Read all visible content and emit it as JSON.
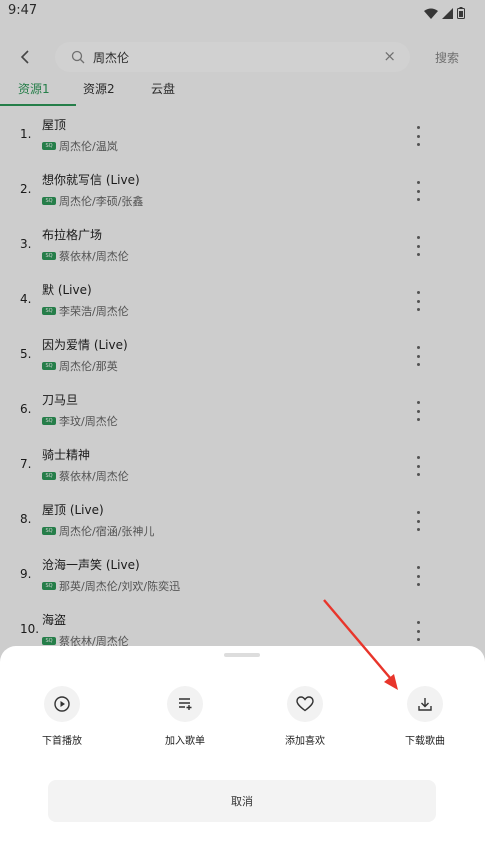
{
  "status": {
    "time": "9:47"
  },
  "search": {
    "query": "周杰伦",
    "button": "搜索"
  },
  "tabs": [
    {
      "label": "资源1"
    },
    {
      "label": "资源2"
    },
    {
      "label": "云盘"
    }
  ],
  "badge": "SQ",
  "songs": [
    {
      "index": "1.",
      "title": "屋顶",
      "artists": "周杰伦/温岚"
    },
    {
      "index": "2.",
      "title": "想你就写信 (Live)",
      "artists": "周杰伦/李硕/张鑫"
    },
    {
      "index": "3.",
      "title": "布拉格广场",
      "artists": "蔡依林/周杰伦"
    },
    {
      "index": "4.",
      "title": "默 (Live)",
      "artists": "李荣浩/周杰伦"
    },
    {
      "index": "5.",
      "title": "因为爱情 (Live)",
      "artists": "周杰伦/那英"
    },
    {
      "index": "6.",
      "title": "刀马旦",
      "artists": "李玟/周杰伦"
    },
    {
      "index": "7.",
      "title": "骑士精神",
      "artists": "蔡依林/周杰伦"
    },
    {
      "index": "8.",
      "title": "屋顶 (Live)",
      "artists": "周杰伦/宿涵/张神儿"
    },
    {
      "index": "9.",
      "title": "沧海一声笑 (Live)",
      "artists": "那英/周杰伦/刘欢/陈奕迅"
    },
    {
      "index": "10.",
      "title": "海盗",
      "artists": "蔡依林/周杰伦"
    }
  ],
  "sheet": {
    "actions": [
      {
        "label": "下首播放",
        "icon": "play-next-icon"
      },
      {
        "label": "加入歌单",
        "icon": "add-playlist-icon"
      },
      {
        "label": "添加喜欢",
        "icon": "heart-icon"
      },
      {
        "label": "下载歌曲",
        "icon": "download-icon"
      }
    ],
    "cancel": "取消"
  },
  "colors": {
    "accent": "#2e9a5a",
    "annotation": "#e8352b"
  }
}
